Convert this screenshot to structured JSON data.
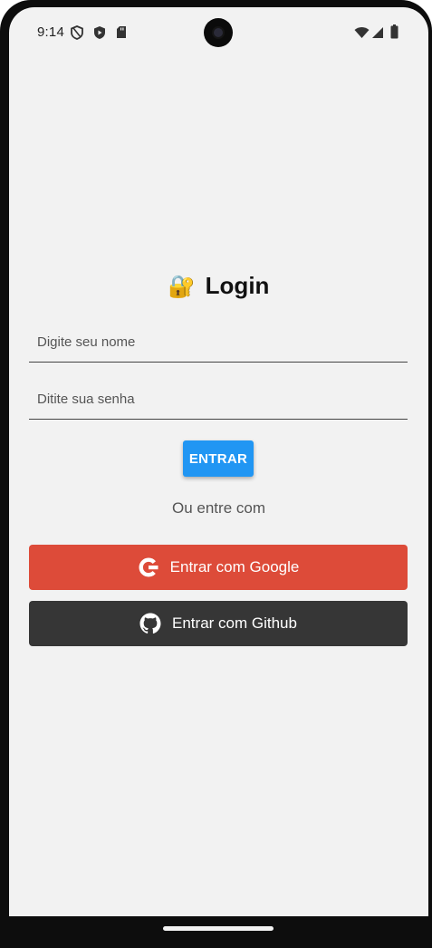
{
  "status_bar": {
    "time": "9:14",
    "left_icons": [
      "vpn-shield-icon",
      "play-protect-icon",
      "sd-card-icon"
    ],
    "right_icons": [
      "wifi-icon",
      "signal-icon",
      "battery-icon"
    ]
  },
  "login": {
    "title_emoji": "🔐",
    "title": "Login",
    "name_placeholder": "Digite seu nome",
    "password_placeholder": "Ditite sua senha",
    "enter_label": "ENTRAR",
    "or_text": "Ou entre com",
    "google_label": "Entrar com Google",
    "github_label": "Entrar com Github"
  },
  "colors": {
    "background": "#f2f2f2",
    "primary_button": "#2196f3",
    "google_button": "#dd4b39",
    "github_button": "#363636"
  }
}
